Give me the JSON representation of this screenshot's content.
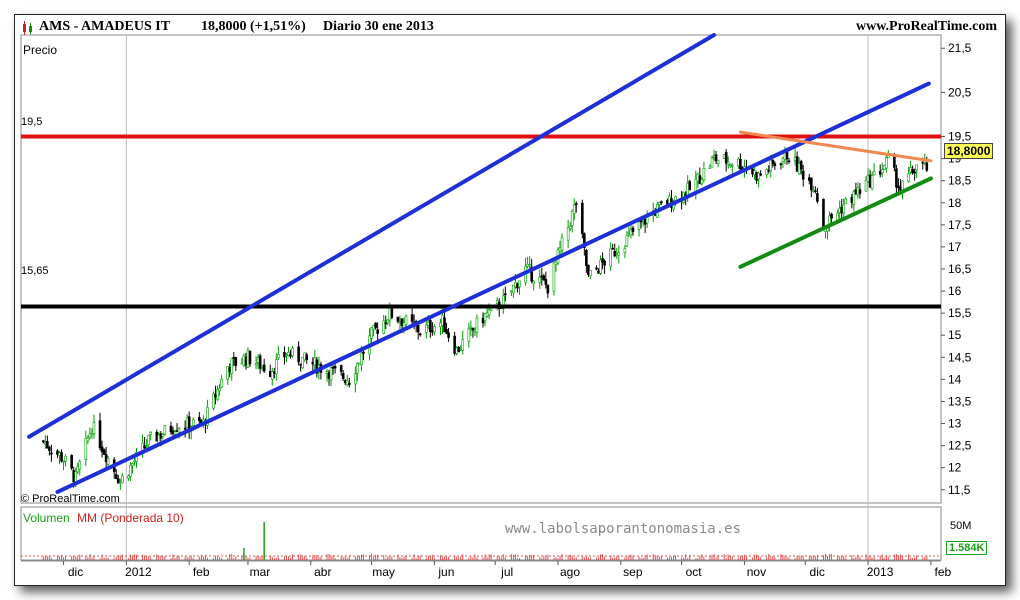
{
  "header": {
    "symbol": "AMS - AMADEUS IT",
    "price": "18,8000 (+1,51%)",
    "period": "Diario  30 ene 2013",
    "site": "www.ProRealTime.com"
  },
  "panel_labels": {
    "price": "Precio",
    "volume_a": "Volumen",
    "volume_b": "MM (Ponderada 10)",
    "copyright": "© ProRealTime.com",
    "watermark": "www.labolsaporantonomasia.es"
  },
  "colors": {
    "up_candle": "#00a000",
    "down_candle": "#000000",
    "channel": "#1f2fd8",
    "resistance": "#e01010",
    "support": "#000000",
    "triangle_upper": "#f08850",
    "triangle_lower": "#138a13",
    "last_price_tag": "#ffff55",
    "volume_bars": "#e05050"
  },
  "chart_data": {
    "type": "candlestick",
    "title": "AMS - AMADEUS IT",
    "ylabel": "Precio",
    "ylim": [
      11.2,
      21.8
    ],
    "y_ticks": [
      "21,5",
      "20,5",
      "19,5",
      "19",
      "18,5",
      "18",
      "17,5",
      "17",
      "16,5",
      "16",
      "15,5",
      "15",
      "14,5",
      "14",
      "13,5",
      "13",
      "12,5",
      "12",
      "11,5"
    ],
    "x_ticks": [
      "dic",
      "2012",
      "feb",
      "mar",
      "abr",
      "may",
      "jun",
      "jul",
      "ago",
      "sep",
      "oct",
      "nov",
      "dic",
      "2013",
      "feb"
    ],
    "last_price": "18,8000",
    "horizontal_levels": [
      {
        "label": "19,5",
        "value": 19.5
      },
      {
        "label": "15,65",
        "value": 15.65
      }
    ],
    "price_path": [
      [
        "2011-11-21",
        12.6
      ],
      [
        "2011-12-01",
        12.2
      ],
      [
        "2011-12-07",
        11.75
      ],
      [
        "2011-12-15",
        12.95
      ],
      [
        "2011-12-22",
        12.3
      ],
      [
        "2011-12-29",
        11.7
      ],
      [
        "2012-01-12",
        12.6
      ],
      [
        "2012-01-25",
        12.95
      ],
      [
        "2012-02-08",
        13.0
      ],
      [
        "2012-02-20",
        14.3
      ],
      [
        "2012-03-01",
        14.5
      ],
      [
        "2012-03-12",
        14.2
      ],
      [
        "2012-03-20",
        14.6
      ],
      [
        "2012-04-02",
        14.35
      ],
      [
        "2012-04-20",
        14.0
      ],
      [
        "2012-05-01",
        15.0
      ],
      [
        "2012-05-10",
        15.5
      ],
      [
        "2012-05-25",
        15.1
      ],
      [
        "2012-06-05",
        15.3
      ],
      [
        "2012-06-12",
        14.65
      ],
      [
        "2012-06-25",
        15.4
      ],
      [
        "2012-07-06",
        15.8
      ],
      [
        "2012-07-16",
        16.5
      ],
      [
        "2012-07-27",
        16.1
      ],
      [
        "2012-08-10",
        18.0
      ],
      [
        "2012-08-16",
        16.3
      ],
      [
        "2012-08-31",
        17.0
      ],
      [
        "2012-09-17",
        17.8
      ],
      [
        "2012-10-05",
        18.3
      ],
      [
        "2012-10-17",
        19.0
      ],
      [
        "2012-10-30",
        18.9
      ],
      [
        "2012-11-08",
        18.6
      ],
      [
        "2012-11-22",
        19.1
      ],
      [
        "2012-12-06",
        18.35
      ],
      [
        "2012-12-10",
        17.45
      ],
      [
        "2012-12-19",
        17.9
      ],
      [
        "2013-01-04",
        18.6
      ],
      [
        "2013-01-11",
        18.95
      ],
      [
        "2013-01-17",
        18.3
      ],
      [
        "2013-01-25",
        18.85
      ],
      [
        "2013-01-30",
        18.8
      ]
    ],
    "trendlines": [
      {
        "name": "channel_lower",
        "start": [
          "2011-11-28",
          11.45
        ],
        "end": [
          "2013-01-31",
          20.7
        ]
      },
      {
        "name": "channel_upper",
        "start": [
          "2011-11-14",
          12.7
        ],
        "end": [
          "2012-10-17",
          21.8
        ]
      },
      {
        "name": "triangle_upper",
        "start": [
          "2012-10-30",
          19.6
        ],
        "end": [
          "2013-02-01",
          18.95
        ]
      },
      {
        "name": "triangle_lower",
        "start": [
          "2012-10-30",
          16.55
        ],
        "end": [
          "2013-02-01",
          18.55
        ]
      }
    ],
    "volume": {
      "label": "Volumen MM (Ponderada 10)",
      "axis_max_label": "50M",
      "last_value": "1.584K",
      "spike_dates": [
        "2012-02-28",
        "2012-03-09"
      ]
    }
  }
}
